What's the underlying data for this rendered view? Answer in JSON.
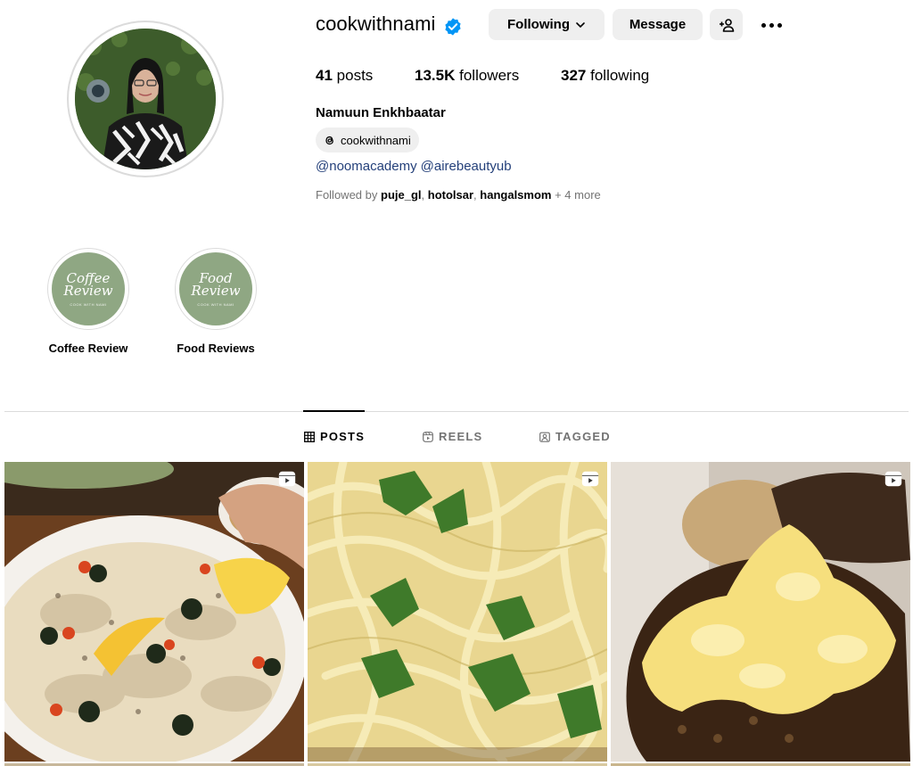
{
  "profile": {
    "username": "cookwithnami",
    "verified": true,
    "verified_icon": "verified-badge-icon",
    "full_name": "Namuun Enkhbaatar",
    "threads_handle": "cookwithnami",
    "bio_links": [
      "@noomacademy",
      "@airebeautyub"
    ],
    "followed_by_prefix": "Followed by",
    "followed_by_users": [
      "puje_gl",
      "hotolsar",
      "hangalsmom"
    ],
    "followed_by_suffix": "+ 4 more"
  },
  "actions": {
    "following_label": "Following",
    "message_label": "Message"
  },
  "stats": {
    "posts_count": "41",
    "posts_label": "posts",
    "followers_count": "13.5K",
    "followers_label": "followers",
    "following_count": "327",
    "following_label": "following"
  },
  "highlights": [
    {
      "script": "Coffee Review",
      "sub": "COOK WITH NAMI",
      "label": "Coffee Review"
    },
    {
      "script": "Food Review",
      "sub": "COOK WITH NAMI",
      "label": "Food Reviews"
    }
  ],
  "tabs": [
    {
      "label": "POSTS",
      "active": true
    },
    {
      "label": "REELS",
      "active": false
    },
    {
      "label": "TAGGED",
      "active": false
    }
  ],
  "colors": {
    "accent_blue": "#0095f6",
    "link_blue": "#24407a",
    "highlight_green": "#8fa783",
    "button_gray": "#efefef"
  }
}
